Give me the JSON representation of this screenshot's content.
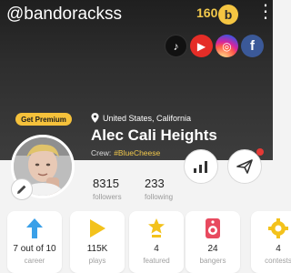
{
  "header": {
    "username": "@bandorackss",
    "coins": "160",
    "coin_symbol": "b",
    "menu_symbol": "⋮"
  },
  "social": {
    "tiktok_symbol": "♪",
    "youtube_symbol": "▶",
    "instagram_symbol": "◎",
    "facebook_symbol": "f"
  },
  "profile": {
    "premium_label": "Get Premium",
    "location": "United States, California",
    "display_name": "Alec Cali Heights",
    "crew_label": "Crew:",
    "crew_name": "#BlueCheese"
  },
  "stats": {
    "followers_value": "8315",
    "followers_label": "followers",
    "following_value": "233",
    "following_label": "following"
  },
  "cards": [
    {
      "value": "7 out of 10",
      "label": "career",
      "icon": "arrow-up-icon",
      "color": "#3aa0e8"
    },
    {
      "value": "115K",
      "label": "plays",
      "icon": "play-icon",
      "color": "#f3c21c"
    },
    {
      "value": "4",
      "label": "featured",
      "icon": "star-trophy-icon",
      "color": "#f3c21c"
    },
    {
      "value": "24",
      "label": "bangers",
      "icon": "speaker-icon",
      "color": "#e84a5f"
    },
    {
      "value": "4",
      "label": "contests",
      "icon": "gear-badge-icon",
      "color": "#f3c21c"
    }
  ],
  "colors": {
    "accent_gold": "#f2c94c",
    "header_dark": "#2a2a2a",
    "notification_red": "#e53935"
  }
}
